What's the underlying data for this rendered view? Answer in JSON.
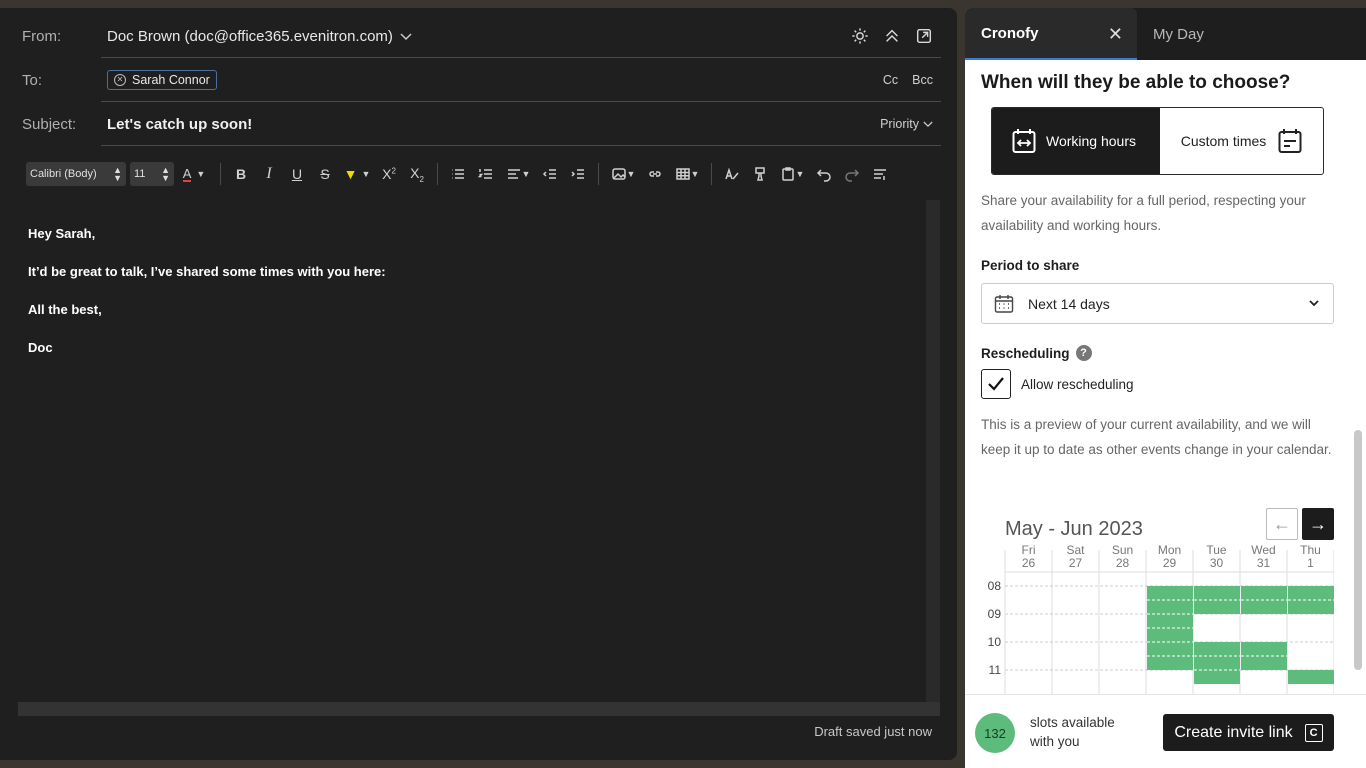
{
  "compose": {
    "from_label": "From:",
    "from_value": "Doc Brown (doc@office365.evenitron.com)",
    "to_label": "To:",
    "to_recipient": "Sarah Connor",
    "cc": "Cc",
    "bcc": "Bcc",
    "subject_label": "Subject:",
    "subject_value": "Let's catch up soon!",
    "priority": "Priority",
    "font_name": "Calibri (Body)",
    "font_size": "11",
    "body_lines": [
      "Hey Sarah,",
      "It’d be great to talk, I’ve shared some times with you here:",
      "All the best,",
      "Doc"
    ],
    "draft_status": "Draft saved just now"
  },
  "panel": {
    "tab_active": "Cronofy",
    "tab_other": "My Day",
    "heading": "When will they be able to choose?",
    "option_working": "Working hours",
    "option_custom": "Custom times",
    "share_desc": "Share your availability for a full period, respecting your availability and working hours.",
    "period_label": "Period to share",
    "period_value": "Next 14 days",
    "rescheduling_label": "Rescheduling",
    "allow_rescheduling": "Allow rescheduling",
    "allow_rescheduling_checked": true,
    "preview_desc": "This is a preview of your current availability, and we will keep it up to date as other events change in your calendar.",
    "calendar_title": "May - Jun 2023",
    "days": [
      {
        "dow": "Fri",
        "date": "26"
      },
      {
        "dow": "Sat",
        "date": "27"
      },
      {
        "dow": "Sun",
        "date": "28"
      },
      {
        "dow": "Mon",
        "date": "29"
      },
      {
        "dow": "Tue",
        "date": "30"
      },
      {
        "dow": "Wed",
        "date": "31"
      },
      {
        "dow": "Thu",
        "date": "1"
      }
    ],
    "hours": [
      "08",
      "09",
      "10",
      "11"
    ],
    "availability_color": "#5dbb7c",
    "available_blocks": [
      {
        "day": 3,
        "start": 8.0,
        "end": 11.0
      },
      {
        "day": 4,
        "start": 8.0,
        "end": 9.0
      },
      {
        "day": 4,
        "start": 10.0,
        "end": 11.5
      },
      {
        "day": 5,
        "start": 8.0,
        "end": 9.0
      },
      {
        "day": 5,
        "start": 10.0,
        "end": 11.0
      },
      {
        "day": 6,
        "start": 8.0,
        "end": 9.0
      },
      {
        "day": 6,
        "start": 11.0,
        "end": 11.5
      }
    ],
    "slots_count": "132",
    "slots_text": "slots available with you",
    "create_button": "Create invite link",
    "create_icon_letter": "C"
  }
}
